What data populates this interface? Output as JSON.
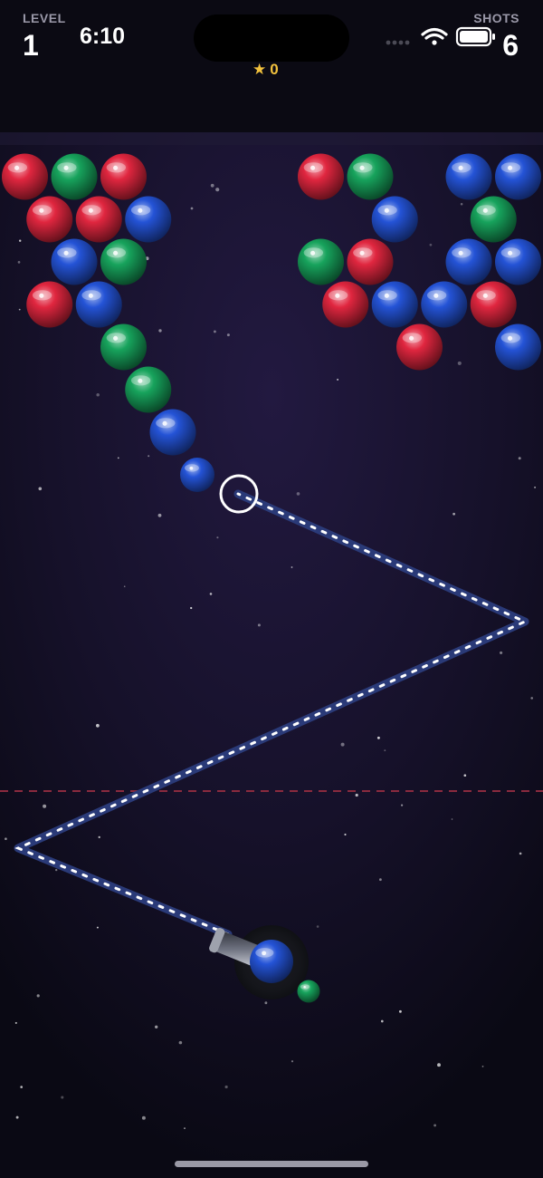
{
  "hud": {
    "level_label": "LEVEL",
    "level_value": "1",
    "clock": "6:10",
    "shots_label": "SHOTS",
    "shots_value": "6",
    "score_star": "★",
    "score_value": "0"
  },
  "status_icons": [
    "cellular-dots-icon",
    "wifi-icon",
    "battery-icon"
  ],
  "colors": {
    "red": "#e0263f",
    "green": "#17a35c",
    "blue": "#2453d6",
    "score": "#f3c23d",
    "background": "#0c0a17",
    "playfield": "#1c1532",
    "deadline": "#8a2a3e"
  },
  "board": {
    "bubbles": [
      {
        "row": 0,
        "col": 0,
        "color": "red"
      },
      {
        "row": 0,
        "col": 1,
        "color": "green"
      },
      {
        "row": 0,
        "col": 2,
        "color": "red"
      },
      {
        "row": 0,
        "col": 6,
        "color": "red"
      },
      {
        "row": 0,
        "col": 7,
        "color": "green"
      },
      {
        "row": 0,
        "col": 9,
        "color": "blue"
      },
      {
        "row": 0,
        "col": 10,
        "color": "blue"
      },
      {
        "row": 1,
        "col": 0,
        "color": "red"
      },
      {
        "row": 1,
        "col": 1,
        "color": "red"
      },
      {
        "row": 1,
        "col": 2,
        "color": "blue"
      },
      {
        "row": 1,
        "col": 7,
        "color": "blue"
      },
      {
        "row": 1,
        "col": 9,
        "color": "green"
      },
      {
        "row": 2,
        "col": 1,
        "color": "blue"
      },
      {
        "row": 2,
        "col": 2,
        "color": "green"
      },
      {
        "row": 2,
        "col": 6,
        "color": "green"
      },
      {
        "row": 2,
        "col": 7,
        "color": "red"
      },
      {
        "row": 2,
        "col": 9,
        "color": "blue"
      },
      {
        "row": 2,
        "col": 10,
        "color": "blue"
      },
      {
        "row": 3,
        "col": 0,
        "color": "red"
      },
      {
        "row": 3,
        "col": 1,
        "color": "blue"
      },
      {
        "row": 3,
        "col": 6,
        "color": "red"
      },
      {
        "row": 3,
        "col": 7,
        "color": "blue"
      },
      {
        "row": 3,
        "col": 8,
        "color": "blue"
      },
      {
        "row": 3,
        "col": 9,
        "color": "red"
      },
      {
        "row": 4,
        "col": 2,
        "color": "green"
      },
      {
        "row": 4,
        "col": 8,
        "color": "red"
      },
      {
        "row": 4,
        "col": 10,
        "color": "blue"
      },
      {
        "row": 5,
        "col": 2,
        "color": "green"
      },
      {
        "row": 6,
        "col": 3,
        "color": "blue"
      }
    ]
  },
  "moving_bubble": {
    "color": "blue"
  },
  "shooter": {
    "loaded": "blue",
    "next": "green"
  }
}
